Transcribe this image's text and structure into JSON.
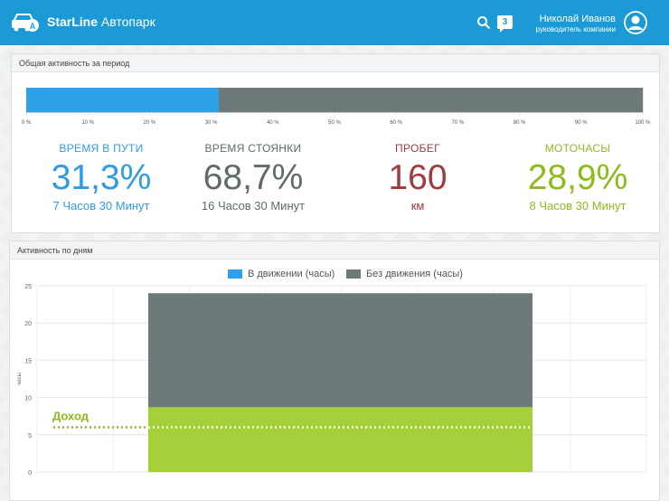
{
  "header": {
    "brand_bold": "StarLine",
    "brand_light": "Автопарк",
    "notification_count": "3",
    "user_name": "Николай Иванов",
    "user_role": "руководитель компании"
  },
  "activity_panel": {
    "title": "Общая активность за период",
    "moving_fraction": 0.313,
    "ticks": [
      "0 %",
      "10 %",
      "20 %",
      "30 %",
      "40 %",
      "50 %",
      "60 %",
      "70 %",
      "80 %",
      "90 %",
      "100 %"
    ],
    "stats": [
      {
        "label": "ВРЕМЯ В ПУТИ",
        "value": "31,3%",
        "sub": "7 Часов 30 Минут",
        "color": "#2f9be3"
      },
      {
        "label": "ВРЕМЯ СТОЯНКИ",
        "value": "68,7%",
        "sub": "16 Часов 30 Минут",
        "color": "#5f6a6a"
      },
      {
        "label": "ПРОБЕГ",
        "value": "160",
        "sub": "км",
        "color": "#a33b3e"
      },
      {
        "label": "МОТОЧАСЫ",
        "value": "28,9%",
        "sub": "8 Часов 30 Минут",
        "color": "#8dbb1c"
      }
    ]
  },
  "daily_panel": {
    "title": "Активность по дням",
    "colors": {
      "moving": "#2fa1e8",
      "idle": "#6e7a7a",
      "extra": "#a6d03a",
      "income_line": "#8dbb1c"
    },
    "chart_data": {
      "type": "bar",
      "stacked": true,
      "ylabel": "часы",
      "ylim": [
        0,
        25
      ],
      "yticks": [
        "0",
        "5",
        "10",
        "15",
        "20",
        "25"
      ],
      "legend_position": "top-center",
      "categories": [
        ""
      ],
      "series": [
        {
          "name": "В движении (часы)",
          "values": [
            8.7
          ],
          "color": "#a6d03a"
        },
        {
          "name": "Без движения (часы)",
          "values": [
            15.3
          ],
          "color": "#6e7a7a"
        }
      ],
      "reference_line": {
        "label": "Доход",
        "value": 6
      }
    }
  }
}
